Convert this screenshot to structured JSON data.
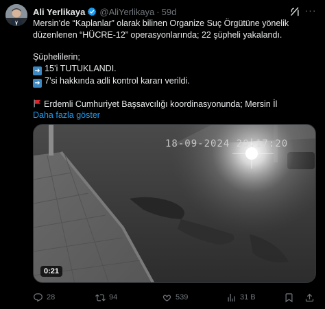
{
  "author": {
    "display_name": "Ali Yerlikaya",
    "handle": "@AliYerlikaya",
    "separator": "·",
    "time": "59d"
  },
  "tweet": {
    "line1": "Mersin’de “Kaplanlar” olarak bilinen Organize Suç Örgütüne yönelik",
    "line2": "düzenlenen “HÜCRE-12” operasyonlarında; 22 şüpheli yakalandı.",
    "line3": "Şüphelilerin;",
    "bullet1": "15’i TUTUKLANDI.",
    "bullet2": "7’si hakkında adli kontrol kararı verildi.",
    "line4": "Erdemli Cumhuriyet Başsavcılığı koordinasyonunda; Mersin İl",
    "show_more": "Daha fazla göster"
  },
  "media": {
    "cctv_timestamp": "18-09-2024 20:17:20",
    "duration": "0:21"
  },
  "actions": {
    "replies": "28",
    "retweets": "94",
    "likes": "539",
    "views": "31 B"
  },
  "colors": {
    "background": "#000000",
    "text": "#e7e9ea",
    "muted": "#71767b",
    "link": "#1d9bf0",
    "verified": "#1d9bf0"
  },
  "icons": [
    "verified-badge-icon",
    "grok-icon",
    "more-icon",
    "arrow-right-emoji-icon",
    "red-flag-emoji-icon",
    "reply-icon",
    "retweet-icon",
    "like-icon",
    "views-icon",
    "bookmark-icon",
    "share-icon"
  ]
}
